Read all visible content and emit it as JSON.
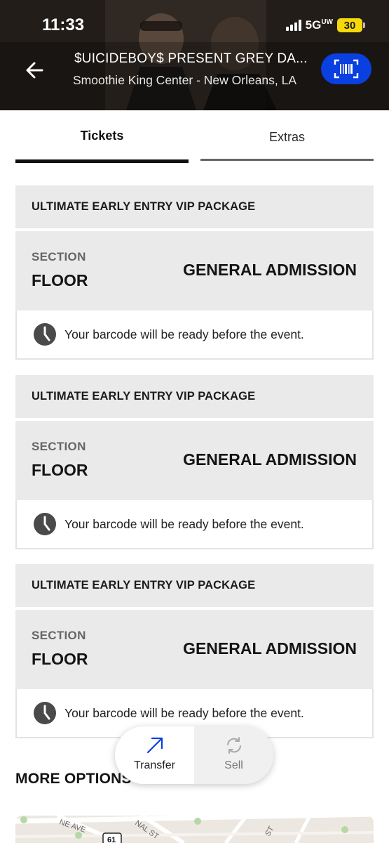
{
  "status_bar": {
    "time": "11:33",
    "network": "5G",
    "network_suffix": "UW",
    "battery": "30"
  },
  "header": {
    "title": "$UICIDEBOY$ PRESENT GREY DA...",
    "venue": "Smoothie King Center - New Orleans, LA",
    "back_icon": "arrow-left-icon",
    "scan_icon": "barcode-scan-icon",
    "accent_color": "#0a3fe0"
  },
  "tabs": [
    {
      "label": "Tickets",
      "active": true
    },
    {
      "label": "Extras",
      "active": false
    }
  ],
  "tickets": [
    {
      "package": "ULTIMATE EARLY ENTRY VIP PACKAGE",
      "section_label": "SECTION",
      "section": "FLOOR",
      "admission": "GENERAL ADMISSION",
      "note": "Your barcode will be ready before the event."
    },
    {
      "package": "ULTIMATE EARLY ENTRY VIP PACKAGE",
      "section_label": "SECTION",
      "section": "FLOOR",
      "admission": "GENERAL ADMISSION",
      "note": "Your barcode will be ready before the event."
    },
    {
      "package": "ULTIMATE EARLY ENTRY VIP PACKAGE",
      "section_label": "SECTION",
      "section": "FLOOR",
      "admission": "GENERAL ADMISSION",
      "note": "Your barcode will be ready before the event."
    }
  ],
  "actions": {
    "transfer": "Transfer",
    "sell": "Sell"
  },
  "more_options": {
    "heading": "MORE OPTIONS",
    "map_labels": [
      "NE AVE",
      "NAL ST",
      "61",
      "ST"
    ]
  }
}
